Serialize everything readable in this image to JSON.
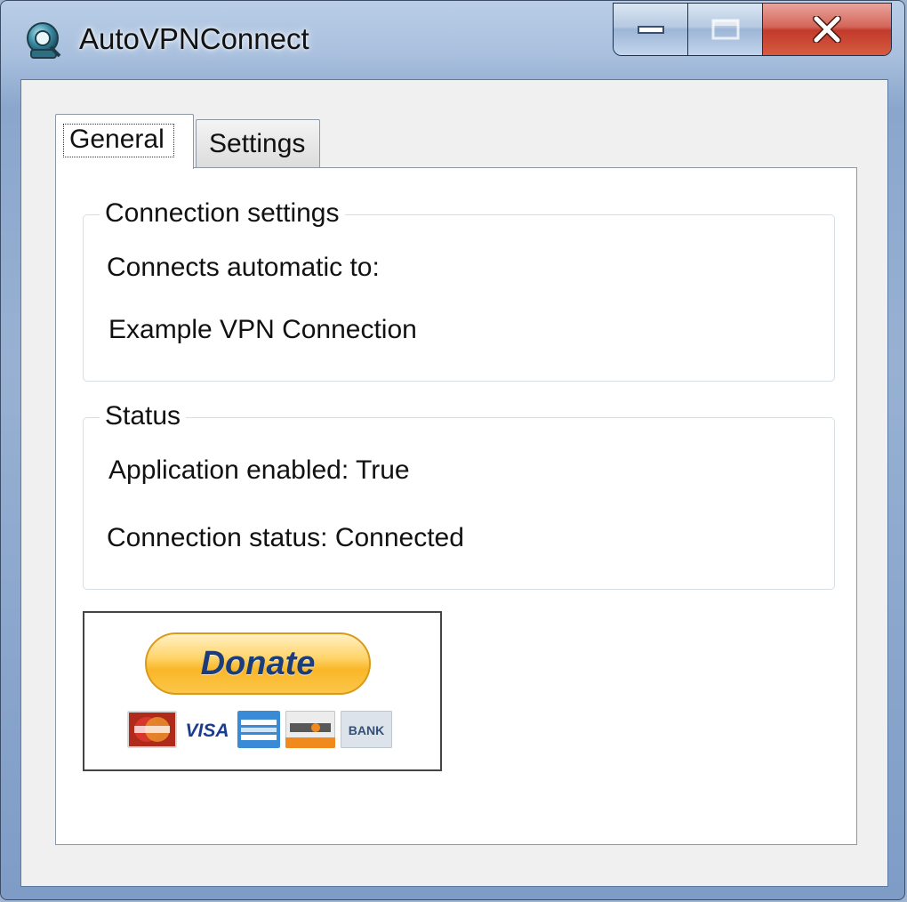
{
  "window": {
    "title": "AutoVPNConnect",
    "app_icon": "vpn-globe-icon",
    "caption_buttons": [
      "minimize-icon",
      "maximize-icon",
      "close-icon"
    ]
  },
  "tabs": [
    {
      "label": "General",
      "selected": true
    },
    {
      "label": "Settings",
      "selected": false
    }
  ],
  "connection_group": {
    "legend": "Connection settings",
    "connects_label": "Connects automatic to:",
    "connection_name": "Example VPN Connection"
  },
  "status_group": {
    "legend": "Status",
    "app_enabled": "Application enabled: True",
    "connection_status": "Connection status: Connected"
  },
  "donate": {
    "label": "Donate",
    "visa_text": "VISA",
    "bank_text": "BANK",
    "card_icons": [
      "mastercard-icon",
      "visa-icon",
      "amex-icon",
      "discover-icon",
      "bank-icon"
    ],
    "colors": {
      "button": "#f9b729",
      "text": "#1c3d7a"
    }
  }
}
